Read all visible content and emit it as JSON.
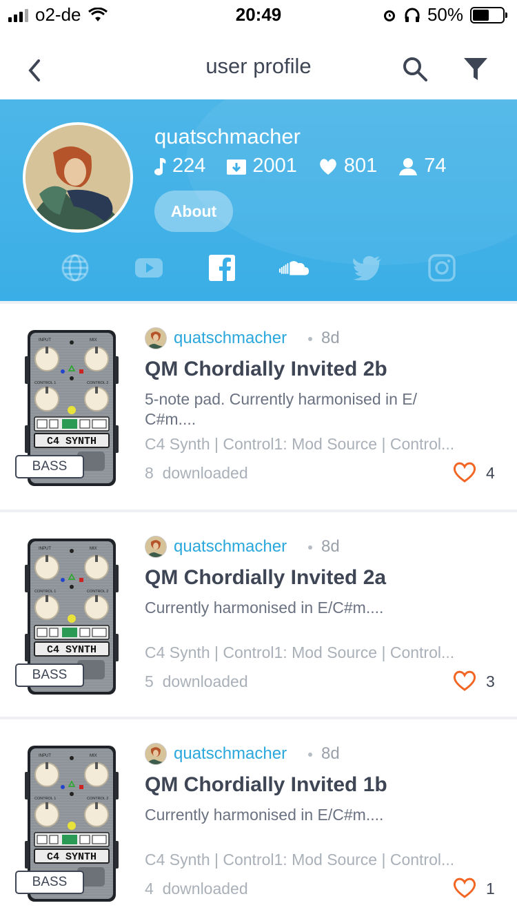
{
  "status_bar": {
    "carrier": "o2-de",
    "time": "20:49",
    "battery": "50%",
    "battery_level": 0.5
  },
  "nav": {
    "title": "user profile",
    "back_icon": "chevron-left-icon",
    "search_icon": "search-icon",
    "filter_icon": "filter-icon"
  },
  "profile": {
    "username": "quatschmacher",
    "stats": {
      "patches": "224",
      "downloads": "2001",
      "likes": "801",
      "followers": "74"
    },
    "about_label": "About",
    "social": [
      "globe-icon",
      "youtube-icon",
      "facebook-icon",
      "soundcloud-icon",
      "twitter-icon",
      "instagram-icon"
    ],
    "colors": {
      "header": "#3aaee6",
      "accent": "#2aa7dc",
      "heart": "#f26522"
    }
  },
  "items": [
    {
      "tag": "BASS",
      "author": "quatschmacher",
      "age": "8d",
      "title": "QM Chordially Invited 2b",
      "desc_line1": "5-note pad. Currently harmonised in E/",
      "desc_line2": "C#m....",
      "meta": "C4 Synth | Control1: Mod Source | Control...",
      "downloads_count": "8",
      "downloads_label": "downloaded",
      "likes": "4"
    },
    {
      "tag": "BASS",
      "author": "quatschmacher",
      "age": "8d",
      "title": "QM Chordially Invited 2a",
      "desc_line1": "Currently harmonised in E/C#m....",
      "desc_line2": "",
      "meta": "C4 Synth | Control1: Mod Source | Control...",
      "downloads_count": "5",
      "downloads_label": "downloaded",
      "likes": "3"
    },
    {
      "tag": "BASS",
      "author": "quatschmacher",
      "age": "8d",
      "title": "QM Chordially Invited 1b",
      "desc_line1": "Currently harmonised in E/C#m....",
      "desc_line2": "",
      "meta": "C4 Synth | Control1: Mod Source | Control...",
      "downloads_count": "4",
      "downloads_label": "downloaded",
      "likes": "1"
    }
  ],
  "pedal": {
    "brand": "C4 SYNTH",
    "label_input": "INPUT",
    "label_mix": "MIX",
    "label_control1": "CONTROL 1",
    "label_control2": "CONTROL 2"
  }
}
